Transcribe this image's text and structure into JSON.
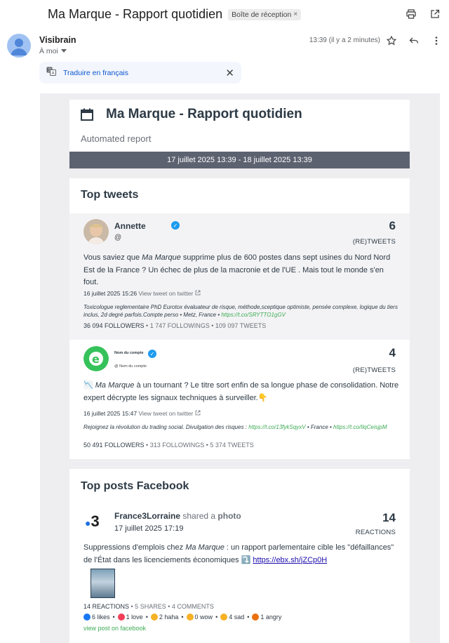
{
  "email": {
    "subject": "Ma Marque  - Rapport quotidien",
    "label": "Boîte de réception",
    "label_close": "×",
    "sender": "Visibrain",
    "recipient": "À moi",
    "time": "13:39 (il y a 2 minutes)",
    "translate": "Traduire en français",
    "translate_close": "✕"
  },
  "report": {
    "title": "Ma Marque  - Rapport quotidien",
    "subtitle": "Automated report",
    "date_range": "17 juillet 2025 13:39 - 18 juillet 2025 13:39"
  },
  "top_tweets": {
    "title": "Top tweets",
    "tweets": [
      {
        "name": "Annette",
        "handle": "@",
        "metric": "6",
        "metric_label": "(RE)TWEETS",
        "text_a": "Vous saviez que ",
        "text_brand": "Ma Marque",
        "text_b": "  supprime plus de 600 postes dans sept usines du Nord Nord Est de la France ? Un échec de plus de la macronie et de l'UE . Mais tout le monde s'en fout.",
        "date": "16 juillet 2025 15:26",
        "view": "View tweet on twitter",
        "bio": "Toxicologue reglementaire PhD Eurotox évaluateur de risque, méthode,sceptique optimiste, pensée complexe, logique du tiers inclus, 2d degré parfois.Compte perso • Metz, France • ",
        "bio_link": "https://t.co/SRYTTO1gGV",
        "followers": "36 094 FOLLOWERS",
        "rest": " • 1 747 FOLLOWINGS • 109 097 TWEETS"
      },
      {
        "name": "Nom du compte",
        "handle": "@ Nom du compte",
        "metric": "4",
        "metric_label": "(RE)TWEETS",
        "text_a": "📉 ",
        "text_brand": "Ma Marque",
        "text_b": "  à un tournant ? Le titre sort enfin de sa longue phase de consolidation. Notre expert décrypte les signaux techniques à surveiller.👇",
        "date": "16 juillet 2025 15:47",
        "view": "View tweet on twitter",
        "bio": "Rejoignez la révolution du trading social. Divulgation des risques : ",
        "bio_link": "https://t.co/13fykSqyxV",
        "bio_mid": " • France • ",
        "bio_link2": "https://t.co/IlqCeisjpM",
        "followers": "50 491 FOLLOWERS",
        "rest": " • 313 FOLLOWINGS • 5 374 TWEETS"
      }
    ]
  },
  "top_facebook": {
    "title": "Top posts Facebook",
    "post": {
      "logo": "3",
      "author": "France3Lorraine",
      "shared": " shared a ",
      "type": "photo",
      "date": "17 juillet 2025 17:19",
      "metric": "14",
      "metric_label": "REACTIONS",
      "text_a": "Suppressions d'emplois chez ",
      "text_brand": "Ma Marque",
      "text_b": " : un rapport parlementaire cible les \"défaillances\" de l'État dans les licenciements économiques ⤵️ ",
      "link": "https://ebx.sh/jZCp0H",
      "reactions_count": "14 REACTIONS",
      "stats_rest": " • 5 SHARES • 4 COMMENTS",
      "reactions": [
        {
          "label": "6 likes",
          "color": "#1877f2"
        },
        {
          "label": "1 love",
          "color": "#f33e58"
        },
        {
          "label": "2 haha",
          "color": "#f7b125"
        },
        {
          "label": "0 wow",
          "color": "#f7b125"
        },
        {
          "label": "4 sad",
          "color": "#f7b125"
        },
        {
          "label": "1 angry",
          "color": "#e9710f"
        }
      ],
      "view": "view post on facebook"
    }
  }
}
